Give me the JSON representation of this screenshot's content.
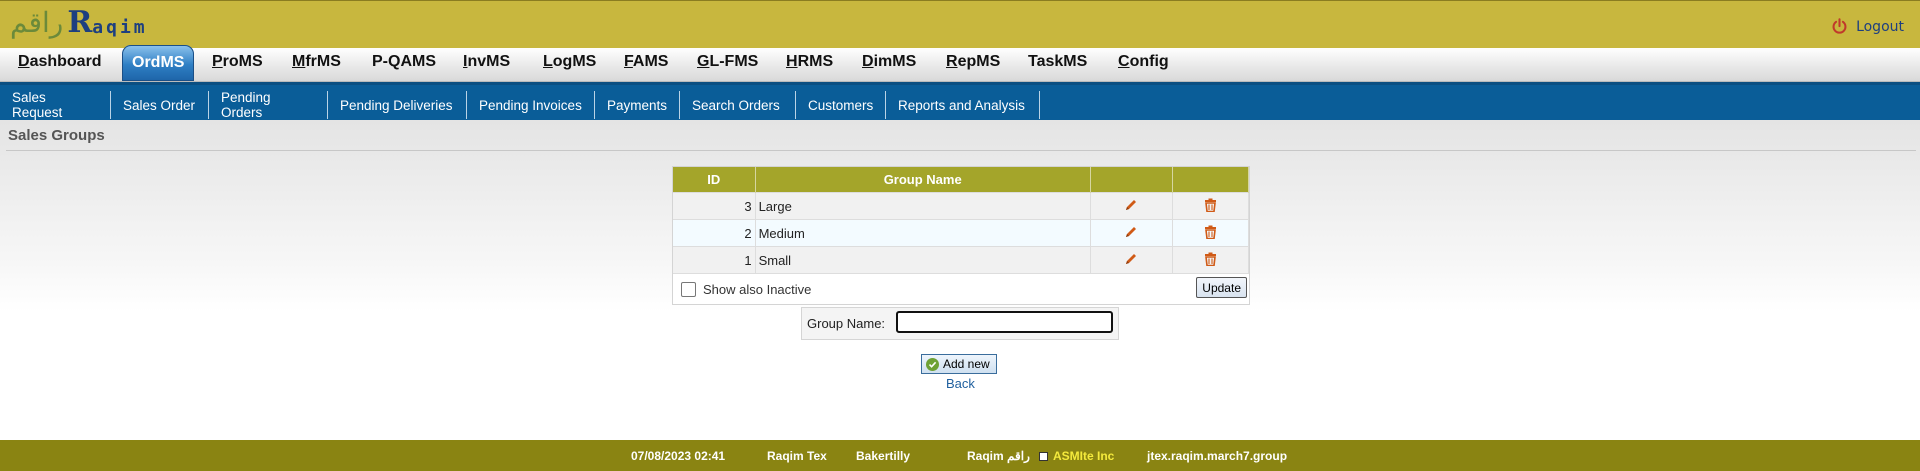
{
  "header": {
    "logo_arabic": "راقم",
    "logo_mark": "R",
    "logo_english": "aqim",
    "logout_label": "Logout"
  },
  "main_nav": {
    "items": [
      {
        "pre": "",
        "u": "D",
        "post": "ashboard"
      },
      {
        "pre": "Ord",
        "u": "M",
        "post": "S",
        "active": true
      },
      {
        "pre": "",
        "u": "P",
        "post": "roMS"
      },
      {
        "pre": "",
        "u": "M",
        "post": "frMS"
      },
      {
        "pre": "P-QAMS",
        "u": "",
        "post": ""
      },
      {
        "pre": "",
        "u": "I",
        "post": "nvMS"
      },
      {
        "pre": "",
        "u": "L",
        "post": "ogMS"
      },
      {
        "pre": "",
        "u": "F",
        "post": "AMS"
      },
      {
        "pre": "",
        "u": "G",
        "post": "L-FMS"
      },
      {
        "pre": "",
        "u": "H",
        "post": "RMS"
      },
      {
        "pre": "",
        "u": "D",
        "post": "imMS"
      },
      {
        "pre": "",
        "u": "R",
        "post": "epMS"
      },
      {
        "pre": "TaskMS",
        "u": "",
        "post": ""
      },
      {
        "pre": "",
        "u": "C",
        "post": "onfig"
      }
    ]
  },
  "sub_nav": {
    "items": [
      "Sales Request",
      "Sales Order",
      "Pending Orders",
      "Pending Deliveries",
      "Pending Invoices",
      "Payments",
      "Search Orders",
      "Customers",
      "Reports and Analysis"
    ]
  },
  "page": {
    "title": "Sales Groups"
  },
  "table": {
    "headers": [
      "ID",
      "Group Name",
      "",
      ""
    ],
    "rows": [
      {
        "id": "3",
        "name": "Large"
      },
      {
        "id": "2",
        "name": "Medium"
      },
      {
        "id": "1",
        "name": "Small"
      }
    ],
    "show_inactive_label": "Show also Inactive",
    "show_inactive_checked": false,
    "update_label": "Update"
  },
  "add_form": {
    "label": "Group Name:",
    "value": "",
    "add_label": "Add new",
    "back_label": "Back"
  },
  "status_bar": {
    "datetime": "07/08/2023 02:41",
    "app": "Raqim Tex",
    "client": "Bakertilly",
    "brand": "Raqim راقم",
    "company": "ASMIte Inc",
    "host": "jtex.raqim.march7.group"
  },
  "colors": {
    "header": "#c8b73e",
    "subnav": "#0a5d98",
    "table_header": "#a4a52a",
    "status_bar": "#8a8412",
    "action_icon": "#d05a16"
  }
}
